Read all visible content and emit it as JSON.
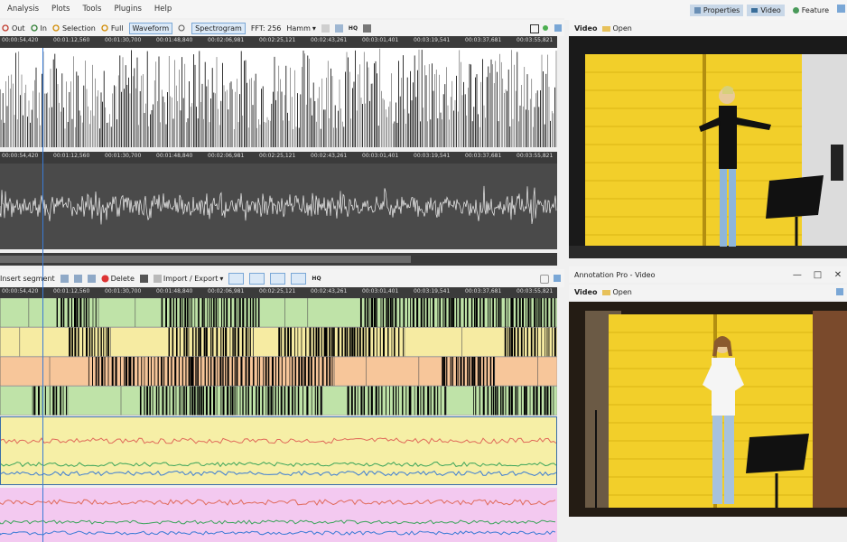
{
  "menu": [
    "Analysis",
    "Plots",
    "Tools",
    "Plugins",
    "Help"
  ],
  "toolbar": {
    "zoom_out": "Out",
    "zoom_in": "In",
    "selection": "Selection",
    "full": "Full",
    "waveform": "Waveform",
    "spectrogram": "Spectrogram",
    "fft": "FFT: 256",
    "window": "Hamm"
  },
  "right_tabs": {
    "properties": "Properties",
    "video": "Video",
    "feature": "Feature"
  },
  "timeline": {
    "labels": [
      "00:00:54,420",
      "00:01:12,560",
      "00:01:30,700",
      "00:01:48,840",
      "00:02:06,981",
      "00:02:25,121",
      "00:02:43,261",
      "00:03:01,401",
      "00:03:19,541",
      "00:03:37,681",
      "00:03:55,821"
    ]
  },
  "annotation_toolbar": {
    "insert_segment": "Insert segment",
    "delete": "Delete",
    "import_export": "Import / Export",
    "hq": "HQ"
  },
  "video_panel_1": {
    "video_label": "Video",
    "open_label": "Open"
  },
  "video_panel_2": {
    "title": "Annotation Pro - Video",
    "video_label": "Video",
    "open_label": "Open"
  },
  "colors": {
    "tier_green": "#bfe3a8",
    "tier_yellow": "#f6eba2",
    "tier_orange": "#f7c69a",
    "feature_yellow": "#f6efa6",
    "feature_pink": "#f3c9f0",
    "waveform_bg": "#4a4a4a",
    "video_wall": "#f2cf2a"
  }
}
